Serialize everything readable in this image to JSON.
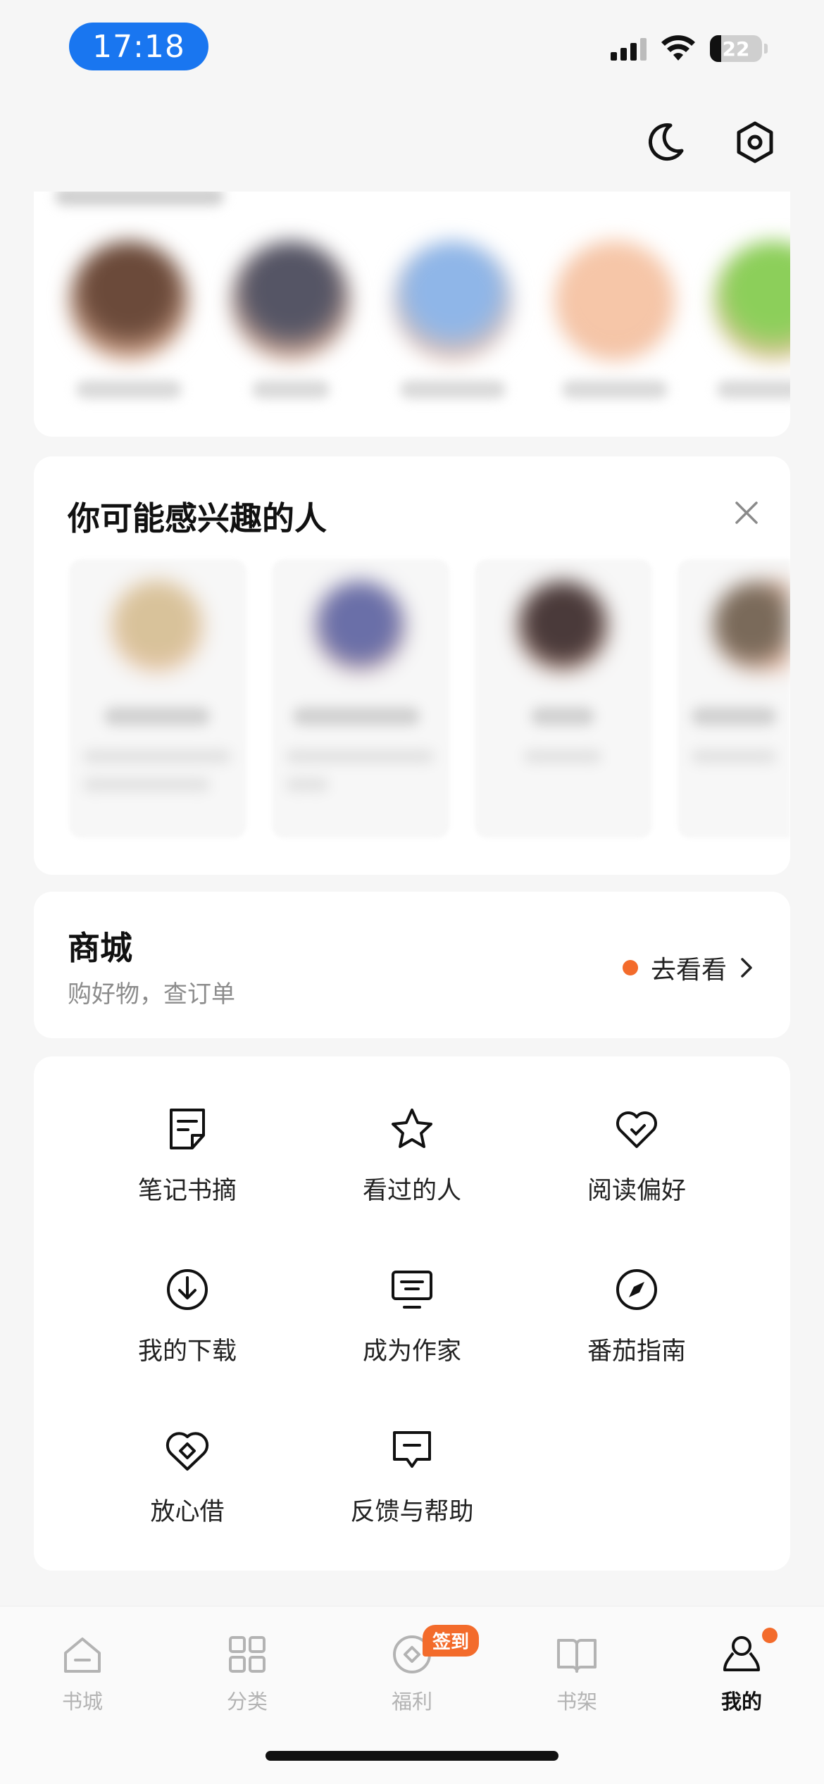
{
  "status_bar": {
    "time": "17:18",
    "battery_level": "22",
    "battery_fraction": 0.22,
    "icons": [
      "signal-icon",
      "wifi-icon",
      "battery-icon"
    ]
  },
  "top_actions": {
    "icons": [
      "moon-icon",
      "settings-icon"
    ]
  },
  "following_section": {
    "avatar_colors": [
      "#6b4a3a",
      "#555565",
      "#8fb6e8",
      "#f6c6a8",
      "#8ccf5a"
    ]
  },
  "suggest_section": {
    "title": "你可能感兴趣的人",
    "close_icon": "close-icon",
    "tile_avatar_colors": [
      "#d8c29a",
      "#6a6fa8",
      "#4a3a3a",
      "#7a6a5a"
    ]
  },
  "mall": {
    "title": "商城",
    "subtitle": "购好物，查订单",
    "action_label": "去看看",
    "dot_color": "#f36b2b"
  },
  "menu": {
    "items": [
      {
        "label": "笔记书摘",
        "icon": "note-icon"
      },
      {
        "label": "看过的人",
        "icon": "star-icon"
      },
      {
        "label": "阅读偏好",
        "icon": "heart-icon"
      },
      {
        "label": "我的下载",
        "icon": "download-icon"
      },
      {
        "label": "成为作家",
        "icon": "monitor-icon"
      },
      {
        "label": "番茄指南",
        "icon": "compass-icon"
      },
      {
        "label": "放心借",
        "icon": "loan-icon"
      },
      {
        "label": "反馈与帮助",
        "icon": "feedback-icon"
      }
    ]
  },
  "tabbar": {
    "tabs": [
      {
        "label": "书城",
        "icon": "home-icon"
      },
      {
        "label": "分类",
        "icon": "grid-icon"
      },
      {
        "label": "福利",
        "icon": "coin-icon",
        "badge": "签到"
      },
      {
        "label": "书架",
        "icon": "book-icon"
      },
      {
        "label": "我的",
        "icon": "profile-icon",
        "active": true
      }
    ],
    "accent_color": "#f36b2b"
  }
}
